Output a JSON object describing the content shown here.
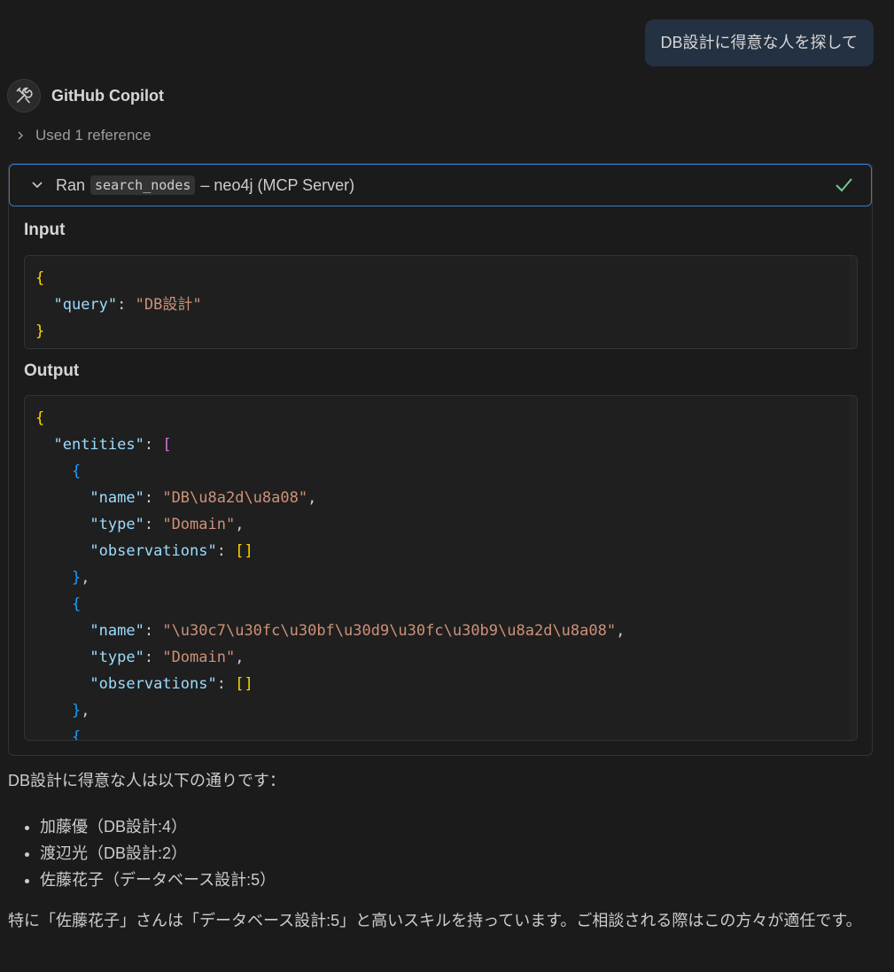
{
  "user_message": "DB設計に得意な人を探して",
  "assistant": {
    "name": "GitHub Copilot",
    "avatar_icon": "tools-icon"
  },
  "references": {
    "label": "Used 1 reference"
  },
  "tool_call": {
    "prefix": "Ran",
    "tool_name": "search_nodes",
    "suffix": "– neo4j (MCP Server)",
    "status": "success",
    "status_color": "#73c991"
  },
  "input": {
    "label": "Input",
    "query_key": "\"query\"",
    "query_value": "\"DB設計\""
  },
  "output": {
    "label": "Output",
    "entities_key": "\"entities\"",
    "entities": [
      {
        "name": "\"DB\\u8a2d\\u8a08\"",
        "type": "\"Domain\""
      },
      {
        "name": "\"\\u30c7\\u30fc\\u30bf\\u30d9\\u30fc\\u30b9\\u8a2d\\u8a08\"",
        "type": "\"Domain\""
      }
    ],
    "name_key": "\"name\"",
    "type_key": "\"type\"",
    "observations_key": "\"observations\""
  },
  "answer": {
    "intro": "DB設計に得意な人は以下の通りです：",
    "items": [
      "加藤優（DB設計:4）",
      "渡辺光（DB設計:2）",
      "佐藤花子（データベース設計:5）"
    ],
    "conclusion": "特に「佐藤花子」さんは「データベース設計:5」と高いスキルを持っています。ご相談される際はこの方々が適任です。"
  }
}
